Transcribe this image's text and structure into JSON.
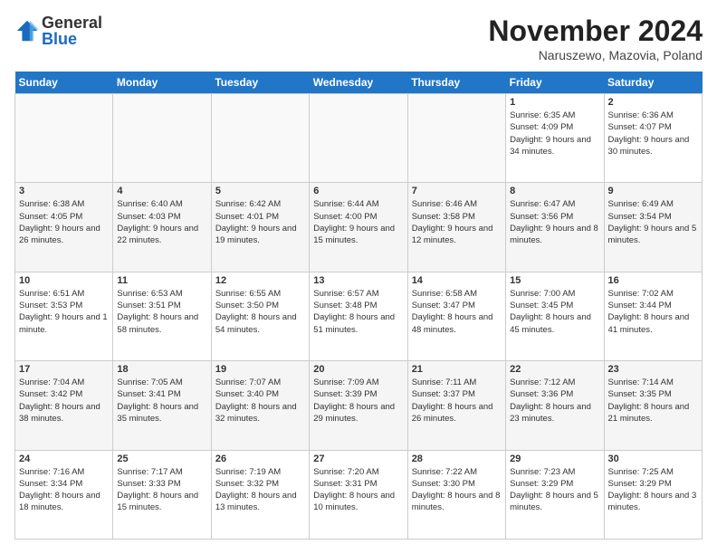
{
  "logo": {
    "general": "General",
    "blue": "Blue"
  },
  "title": "November 2024",
  "location": "Naruszewo, Mazovia, Poland",
  "headers": [
    "Sunday",
    "Monday",
    "Tuesday",
    "Wednesday",
    "Thursday",
    "Friday",
    "Saturday"
  ],
  "weeks": [
    [
      {
        "day": "",
        "info": ""
      },
      {
        "day": "",
        "info": ""
      },
      {
        "day": "",
        "info": ""
      },
      {
        "day": "",
        "info": ""
      },
      {
        "day": "",
        "info": ""
      },
      {
        "day": "1",
        "info": "Sunrise: 6:35 AM\nSunset: 4:09 PM\nDaylight: 9 hours and 34 minutes."
      },
      {
        "day": "2",
        "info": "Sunrise: 6:36 AM\nSunset: 4:07 PM\nDaylight: 9 hours and 30 minutes."
      }
    ],
    [
      {
        "day": "3",
        "info": "Sunrise: 6:38 AM\nSunset: 4:05 PM\nDaylight: 9 hours and 26 minutes."
      },
      {
        "day": "4",
        "info": "Sunrise: 6:40 AM\nSunset: 4:03 PM\nDaylight: 9 hours and 22 minutes."
      },
      {
        "day": "5",
        "info": "Sunrise: 6:42 AM\nSunset: 4:01 PM\nDaylight: 9 hours and 19 minutes."
      },
      {
        "day": "6",
        "info": "Sunrise: 6:44 AM\nSunset: 4:00 PM\nDaylight: 9 hours and 15 minutes."
      },
      {
        "day": "7",
        "info": "Sunrise: 6:46 AM\nSunset: 3:58 PM\nDaylight: 9 hours and 12 minutes."
      },
      {
        "day": "8",
        "info": "Sunrise: 6:47 AM\nSunset: 3:56 PM\nDaylight: 9 hours and 8 minutes."
      },
      {
        "day": "9",
        "info": "Sunrise: 6:49 AM\nSunset: 3:54 PM\nDaylight: 9 hours and 5 minutes."
      }
    ],
    [
      {
        "day": "10",
        "info": "Sunrise: 6:51 AM\nSunset: 3:53 PM\nDaylight: 9 hours and 1 minute."
      },
      {
        "day": "11",
        "info": "Sunrise: 6:53 AM\nSunset: 3:51 PM\nDaylight: 8 hours and 58 minutes."
      },
      {
        "day": "12",
        "info": "Sunrise: 6:55 AM\nSunset: 3:50 PM\nDaylight: 8 hours and 54 minutes."
      },
      {
        "day": "13",
        "info": "Sunrise: 6:57 AM\nSunset: 3:48 PM\nDaylight: 8 hours and 51 minutes."
      },
      {
        "day": "14",
        "info": "Sunrise: 6:58 AM\nSunset: 3:47 PM\nDaylight: 8 hours and 48 minutes."
      },
      {
        "day": "15",
        "info": "Sunrise: 7:00 AM\nSunset: 3:45 PM\nDaylight: 8 hours and 45 minutes."
      },
      {
        "day": "16",
        "info": "Sunrise: 7:02 AM\nSunset: 3:44 PM\nDaylight: 8 hours and 41 minutes."
      }
    ],
    [
      {
        "day": "17",
        "info": "Sunrise: 7:04 AM\nSunset: 3:42 PM\nDaylight: 8 hours and 38 minutes."
      },
      {
        "day": "18",
        "info": "Sunrise: 7:05 AM\nSunset: 3:41 PM\nDaylight: 8 hours and 35 minutes."
      },
      {
        "day": "19",
        "info": "Sunrise: 7:07 AM\nSunset: 3:40 PM\nDaylight: 8 hours and 32 minutes."
      },
      {
        "day": "20",
        "info": "Sunrise: 7:09 AM\nSunset: 3:39 PM\nDaylight: 8 hours and 29 minutes."
      },
      {
        "day": "21",
        "info": "Sunrise: 7:11 AM\nSunset: 3:37 PM\nDaylight: 8 hours and 26 minutes."
      },
      {
        "day": "22",
        "info": "Sunrise: 7:12 AM\nSunset: 3:36 PM\nDaylight: 8 hours and 23 minutes."
      },
      {
        "day": "23",
        "info": "Sunrise: 7:14 AM\nSunset: 3:35 PM\nDaylight: 8 hours and 21 minutes."
      }
    ],
    [
      {
        "day": "24",
        "info": "Sunrise: 7:16 AM\nSunset: 3:34 PM\nDaylight: 8 hours and 18 minutes."
      },
      {
        "day": "25",
        "info": "Sunrise: 7:17 AM\nSunset: 3:33 PM\nDaylight: 8 hours and 15 minutes."
      },
      {
        "day": "26",
        "info": "Sunrise: 7:19 AM\nSunset: 3:32 PM\nDaylight: 8 hours and 13 minutes."
      },
      {
        "day": "27",
        "info": "Sunrise: 7:20 AM\nSunset: 3:31 PM\nDaylight: 8 hours and 10 minutes."
      },
      {
        "day": "28",
        "info": "Sunrise: 7:22 AM\nSunset: 3:30 PM\nDaylight: 8 hours and 8 minutes."
      },
      {
        "day": "29",
        "info": "Sunrise: 7:23 AM\nSunset: 3:29 PM\nDaylight: 8 hours and 5 minutes."
      },
      {
        "day": "30",
        "info": "Sunrise: 7:25 AM\nSunset: 3:29 PM\nDaylight: 8 hours and 3 minutes."
      }
    ]
  ]
}
